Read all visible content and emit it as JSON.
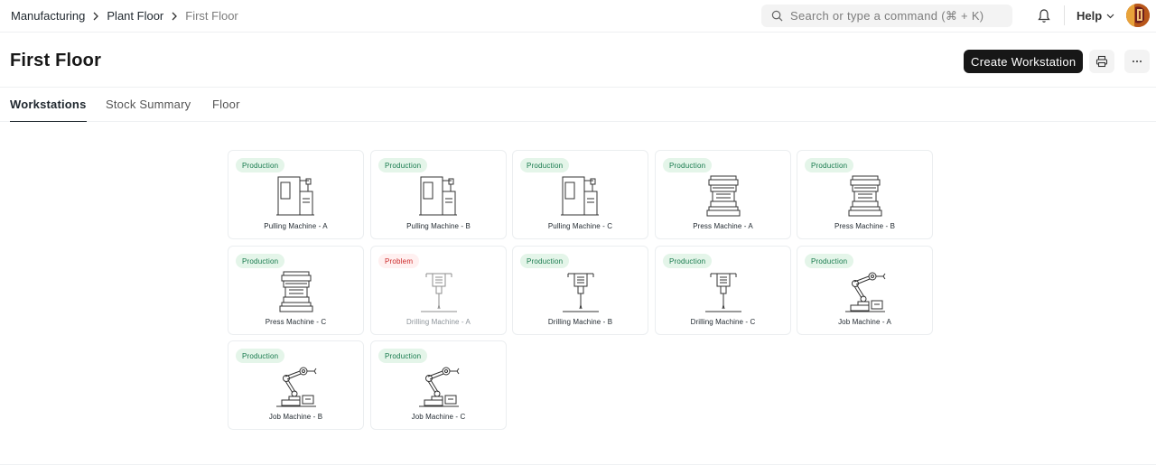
{
  "breadcrumb": {
    "items": [
      "Manufacturing",
      "Plant Floor",
      "First Floor"
    ]
  },
  "search": {
    "placeholder": "Search or type a command (⌘ + K)"
  },
  "navbar": {
    "help_label": "Help",
    "icons": [
      "search-icon",
      "bell-icon",
      "chevron-down-icon",
      "avatar"
    ]
  },
  "page": {
    "title": "First Floor",
    "create_button": "Create Workstation",
    "icons": [
      "printer-icon",
      "more-horizontal-icon"
    ]
  },
  "tabs": [
    {
      "label": "Workstations",
      "active": true
    },
    {
      "label": "Stock Summary",
      "active": false
    },
    {
      "label": "Floor",
      "active": false
    }
  ],
  "colors": {
    "accent": "#171717",
    "production_bg": "#e4f5e9",
    "production_text": "#16794c",
    "problem_bg": "#fff0f0",
    "problem_text": "#cc2929"
  },
  "workstations": [
    {
      "name": "Pulling Machine - A",
      "status": "Production",
      "icon": "pulling-machine-icon"
    },
    {
      "name": "Pulling Machine - B",
      "status": "Production",
      "icon": "pulling-machine-icon"
    },
    {
      "name": "Pulling Machine - C",
      "status": "Production",
      "icon": "pulling-machine-icon"
    },
    {
      "name": "Press Machine - A",
      "status": "Production",
      "icon": "press-machine-icon"
    },
    {
      "name": "Press Machine - B",
      "status": "Production",
      "icon": "press-machine-icon"
    },
    {
      "name": "Press Machine - C",
      "status": "Production",
      "icon": "press-machine-icon"
    },
    {
      "name": "Drilling Machine - A",
      "status": "Problem",
      "icon": "drilling-machine-icon"
    },
    {
      "name": "Drilling Machine - B",
      "status": "Production",
      "icon": "drilling-machine-icon"
    },
    {
      "name": "Drilling Machine - C",
      "status": "Production",
      "icon": "drilling-machine-icon"
    },
    {
      "name": "Job Machine - A",
      "status": "Production",
      "icon": "robot-arm-icon"
    },
    {
      "name": "Job Machine - B",
      "status": "Production",
      "icon": "robot-arm-icon"
    },
    {
      "name": "Job Machine - C",
      "status": "Production",
      "icon": "robot-arm-icon"
    }
  ]
}
